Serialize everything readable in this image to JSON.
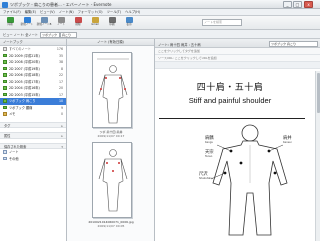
{
  "window": {
    "title": "ツボブック - 肩こりの患者... - エバーノート - Evernote",
    "buttons": {
      "minimize": "_",
      "maximize": "□",
      "close": "x"
    }
  },
  "menu": [
    "ファイル(F)",
    "編集(E)",
    "ビュー(V)",
    "ノート(N)",
    "フォーマット(O)",
    "ツール(T)",
    "ヘルプ(H)"
  ],
  "toolbar": {
    "buttons": [
      {
        "label": "同期",
        "color": "#3a9a3a"
      },
      {
        "label": "新規ノート",
        "color": "#2f7fd6"
      },
      {
        "label": "新規ノートB",
        "color": "#6b8fb5"
      },
      {
        "label": "ノート",
        "color": "#8c8c8c"
      },
      {
        "label": "削除",
        "color": "#c94b4b"
      },
      {
        "label": "Gmail",
        "color": "#c9a43b"
      },
      {
        "label": "印刷",
        "color": "#6d6d6d"
      },
      {
        "label": "表示",
        "color": "#4a8ac9"
      }
    ],
    "search_placeholder": "ノートを検索"
  },
  "subbar": {
    "label": "ビュー ノート: 全ノート",
    "combo1": "ツボブック",
    "combo2": "肩こり"
  },
  "sidebar": {
    "header": "ノートブック",
    "items": [
      {
        "label": "すべてのノート",
        "count": "176",
        "selected": false
      },
      {
        "label": "2D 2009 (平成21年)",
        "count": "35",
        "selected": false
      },
      {
        "label": "2D 2008 (平成20年)",
        "count": "38",
        "selected": false
      },
      {
        "label": "2D 2007 (平成19年)",
        "count": "8",
        "selected": false
      },
      {
        "label": "2D 2006 (平成18年)",
        "count": "22",
        "selected": false
      },
      {
        "label": "2D 2005 (平成17年)",
        "count": "17",
        "selected": false
      },
      {
        "label": "2D 2004 (平成16年)",
        "count": "20",
        "selected": false
      },
      {
        "label": "2D 2003 (平成15年)",
        "count": "17",
        "selected": false
      },
      {
        "label": "ツボブック 肩こり",
        "count": "10",
        "selected": true
      },
      {
        "label": "ツボブック 腰痛",
        "count": "9",
        "selected": false
      },
      {
        "label": "メモ",
        "count": "0",
        "selected": false
      }
    ],
    "sections": [
      {
        "label": "タグ",
        "arrow": "▸"
      },
      {
        "label": "属性",
        "arrow": "▸"
      },
      {
        "label": "保存された検索",
        "arrow": "▾"
      }
    ],
    "saved": [
      {
        "label": "ノート"
      },
      {
        "label": "その他"
      }
    ]
  },
  "notelist": {
    "header": "ノート (有効日順)",
    "cards": [
      {
        "title": "ツボ 肩十四 肩井",
        "date": "2009/11/07 00:17",
        "filename": ""
      },
      {
        "title": "2010021014060071_0006.jpg",
        "date": "2009/11/07 00:05",
        "filename": "2010021014060071_0006.jpg"
      }
    ]
  },
  "editor": {
    "title": "ノート: 肩十四 肩井 : 五十肩",
    "notebook": "ツボブック 肩こり",
    "source_label": "ここをクリックしてタグを追加",
    "font_label": "ソースURL: ここをクリックしてURLを追加",
    "heading_jp": "四十肩・五十肩",
    "heading_en": "Stiff and painful shoulder",
    "points": [
      {
        "jp": "肩髃",
        "en": "Kengu"
      },
      {
        "jp": "肩井",
        "en": "Kensei"
      },
      {
        "jp": "天宗",
        "en": "Tenso"
      },
      {
        "jp": "尺沢",
        "en": "Shakutaku"
      }
    ]
  },
  "colors": {
    "selection": "#3b7dd8",
    "folder": "#6fbf4a",
    "close": "#d85a4f"
  }
}
